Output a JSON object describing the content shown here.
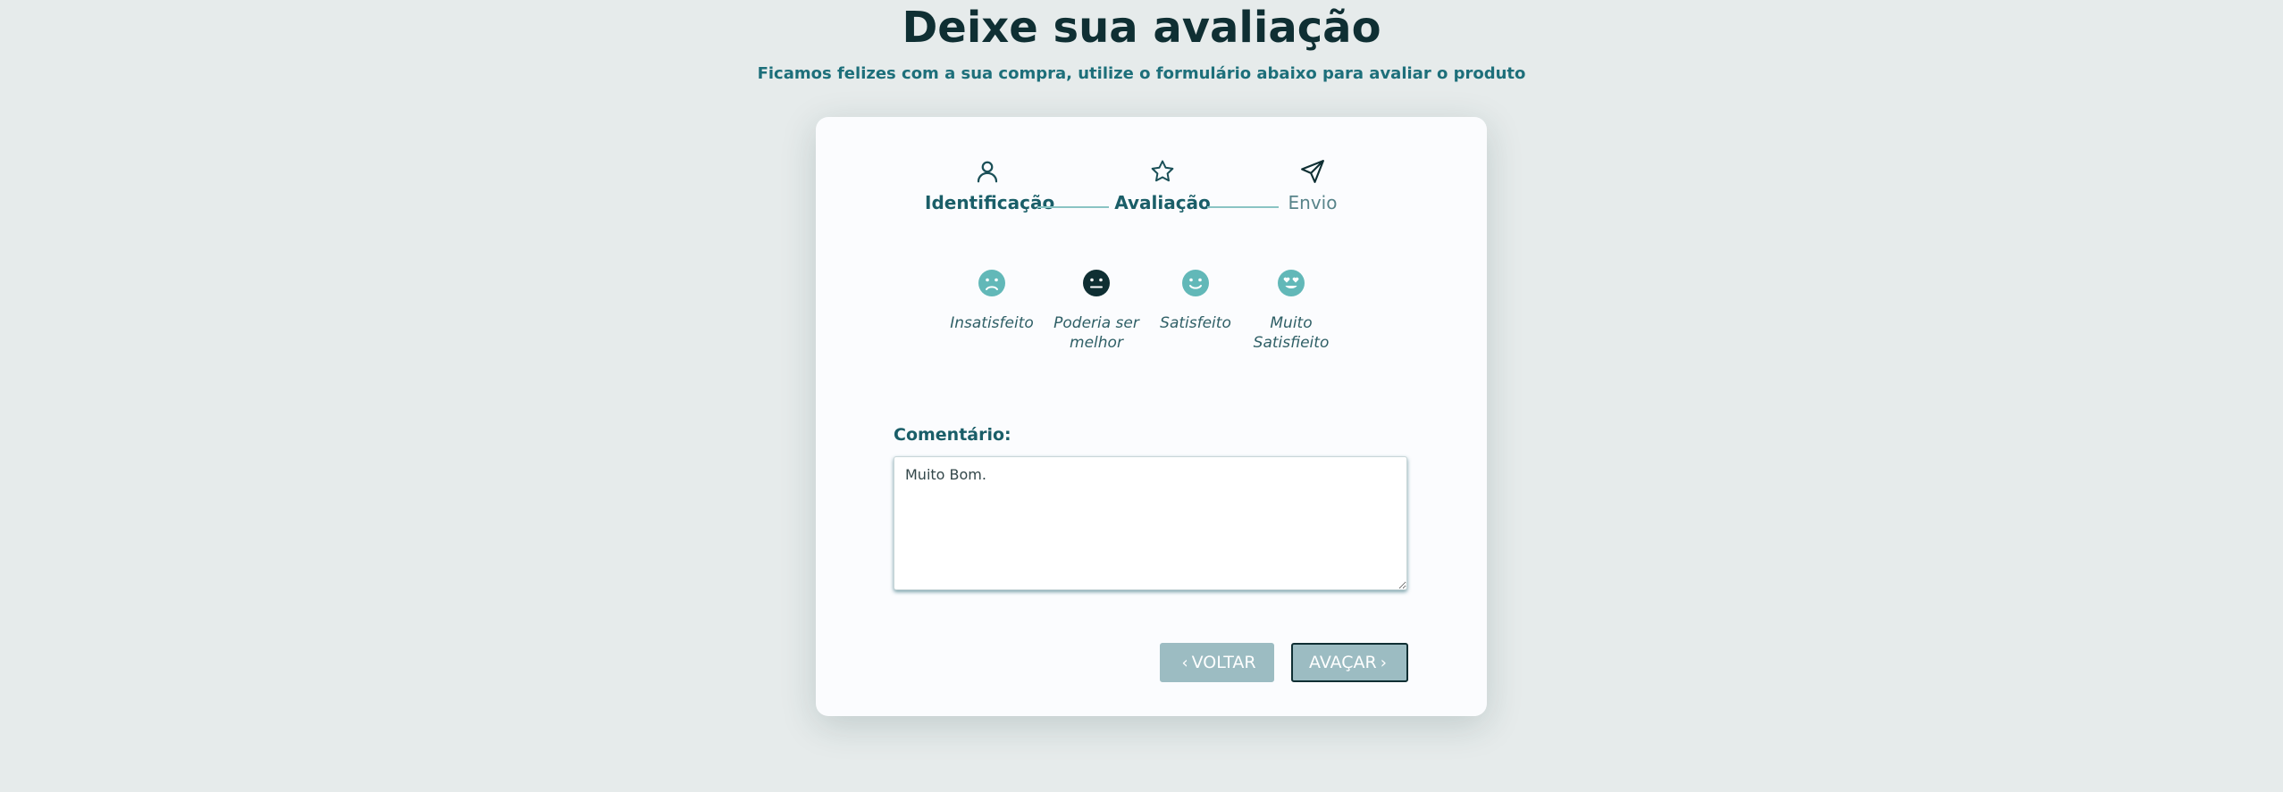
{
  "header": {
    "title": "Deixe sua avaliação",
    "subtitle": "Ficamos felizes com a sua compra, utilize o formulário abaixo para avaliar o produto"
  },
  "steps": [
    {
      "label": "Identificação",
      "icon": "user-icon",
      "state": "completed"
    },
    {
      "label": "Avaliação",
      "icon": "star-icon",
      "state": "active"
    },
    {
      "label": "Envio",
      "icon": "send-icon",
      "state": "pending"
    }
  ],
  "ratings": [
    {
      "label": "Insatisfeito",
      "icon": "frown-face-icon",
      "selected": false
    },
    {
      "label": "Poderia ser melhor",
      "icon": "neutral-face-icon",
      "selected": true
    },
    {
      "label": "Satisfeito",
      "icon": "smile-face-icon",
      "selected": false
    },
    {
      "label": "Muito Satisfieito",
      "icon": "heart-eyes-face-icon",
      "selected": false
    }
  ],
  "comment": {
    "label": "Comentário:",
    "value": "Muito Bom."
  },
  "buttons": {
    "back_label": "VOLTAR",
    "next_label": "AVAÇAR"
  },
  "colors": {
    "accent": "#1a5e68",
    "rating_inactive": "#62b8b8",
    "rating_selected": "#0f2f33",
    "button_bg": "#9cbcc2",
    "background": "#e6ebeb"
  }
}
